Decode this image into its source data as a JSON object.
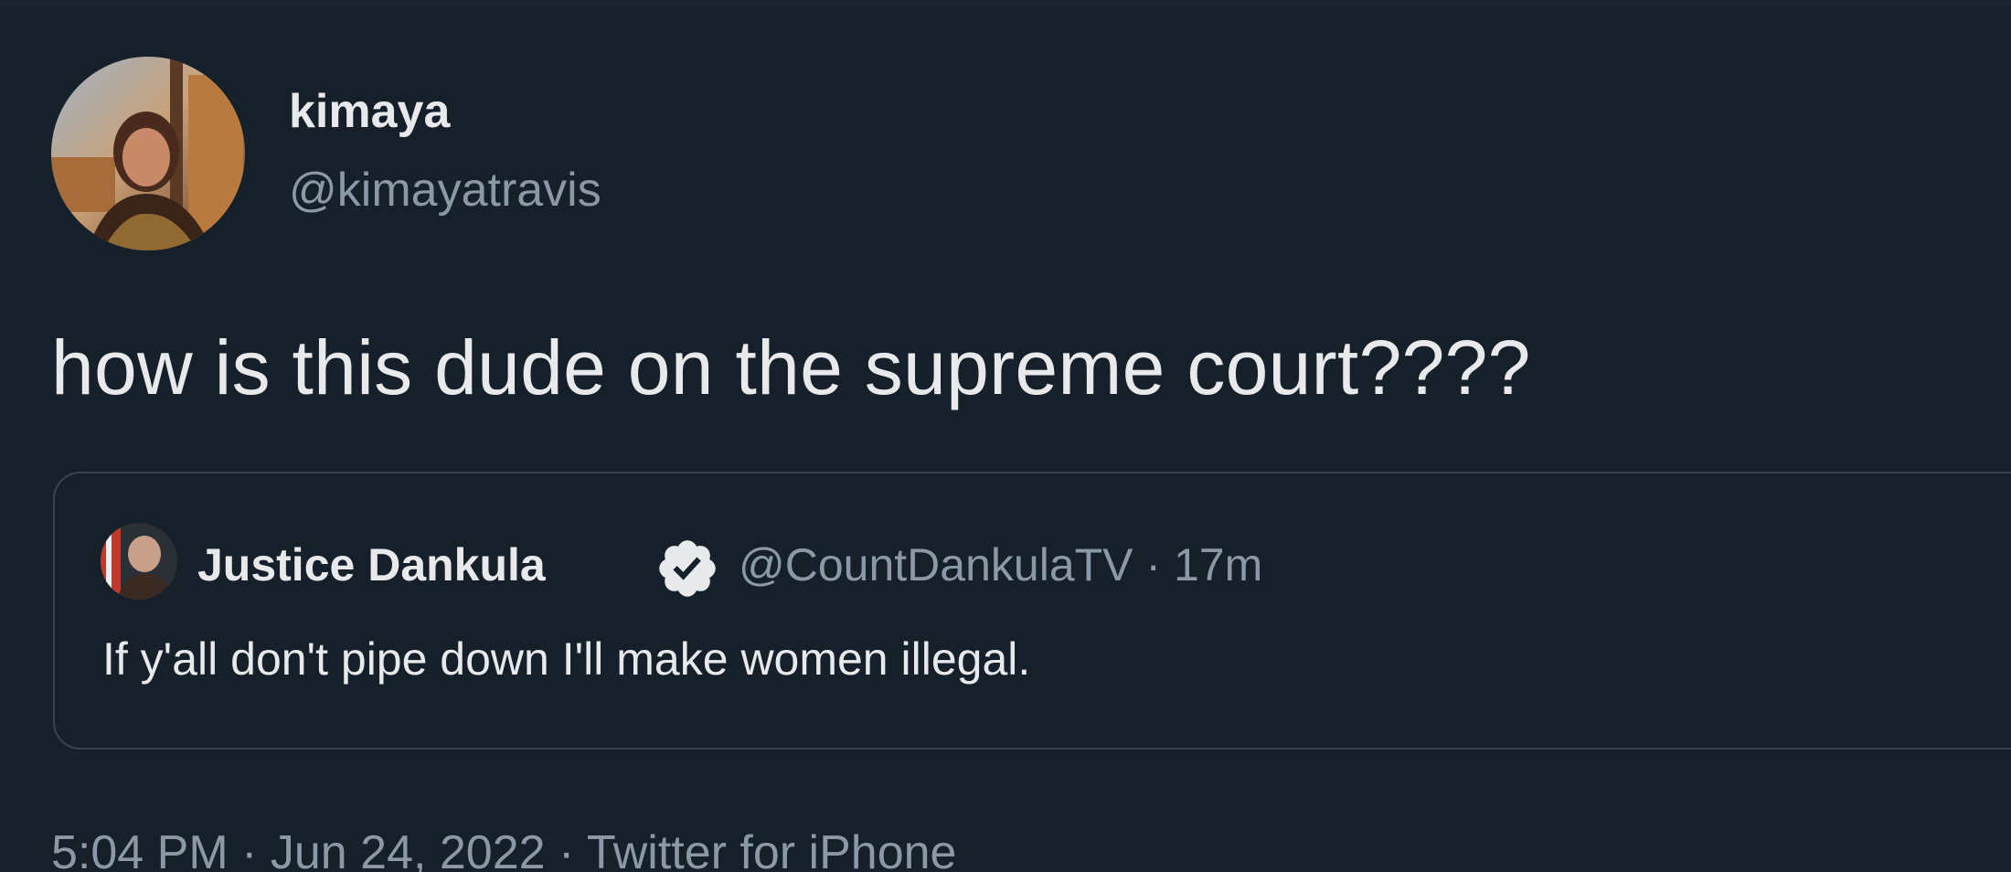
{
  "tweet": {
    "display_name": "kimaya",
    "handle": "@kimayatravis",
    "text": "how is this dude on the supreme court????",
    "meta": "5:04 PM · Jun 24, 2022 · Twitter for iPhone",
    "avatar_icon": "profile-photo"
  },
  "quoted_tweet": {
    "display_name": "Justice Dankula",
    "verified_icon": "verified-badge-icon",
    "handle_time": "@CountDankulaTV · 17m",
    "text": "If y'all don't pipe down I'll make women illegal.",
    "avatar_icon": "profile-photo"
  },
  "colors": {
    "background": "#16202b",
    "primary_text": "#e7e9ea",
    "secondary_text": "#8b98a5",
    "border": "#38444d"
  }
}
